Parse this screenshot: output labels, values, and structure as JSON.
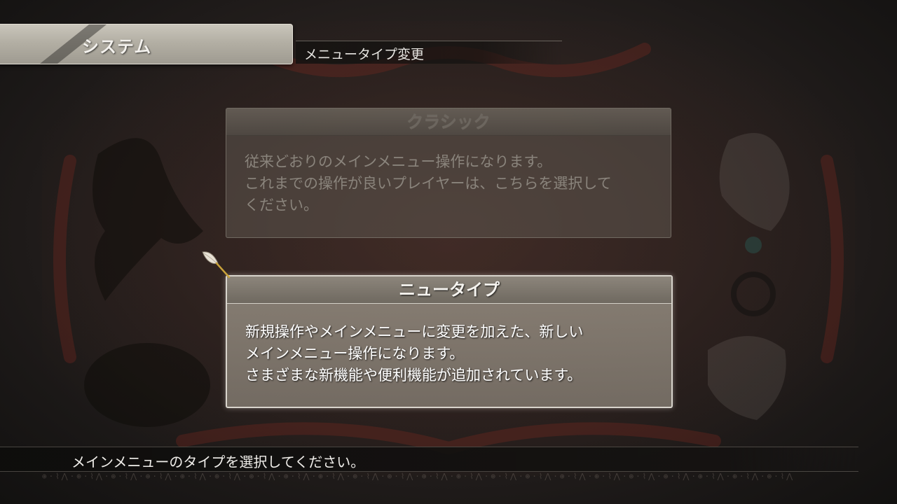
{
  "header": {
    "title": "システム",
    "subtitle": "メニュータイプ変更"
  },
  "options": [
    {
      "title": "クラシック",
      "description": "従来どおりのメインメニュー操作になります。\nこれまでの操作が良いプレイヤーは、こちらを選択して\nください。",
      "selected": false
    },
    {
      "title": "ニュータイプ",
      "description": "新規操作やメインメニューに変更を加えた、新しい\nメインメニュー操作になります。\nさまざまな新機能や便利機能が追加されています。",
      "selected": true
    }
  ],
  "footer": {
    "help_text": "メインメニューのタイプを選択してください。"
  },
  "icons": {
    "cursor": "quill-feather-icon"
  },
  "colors": {
    "selected_card": "#8c857b",
    "unselected_card": "#5c564e",
    "text_primary": "#ffffff"
  }
}
